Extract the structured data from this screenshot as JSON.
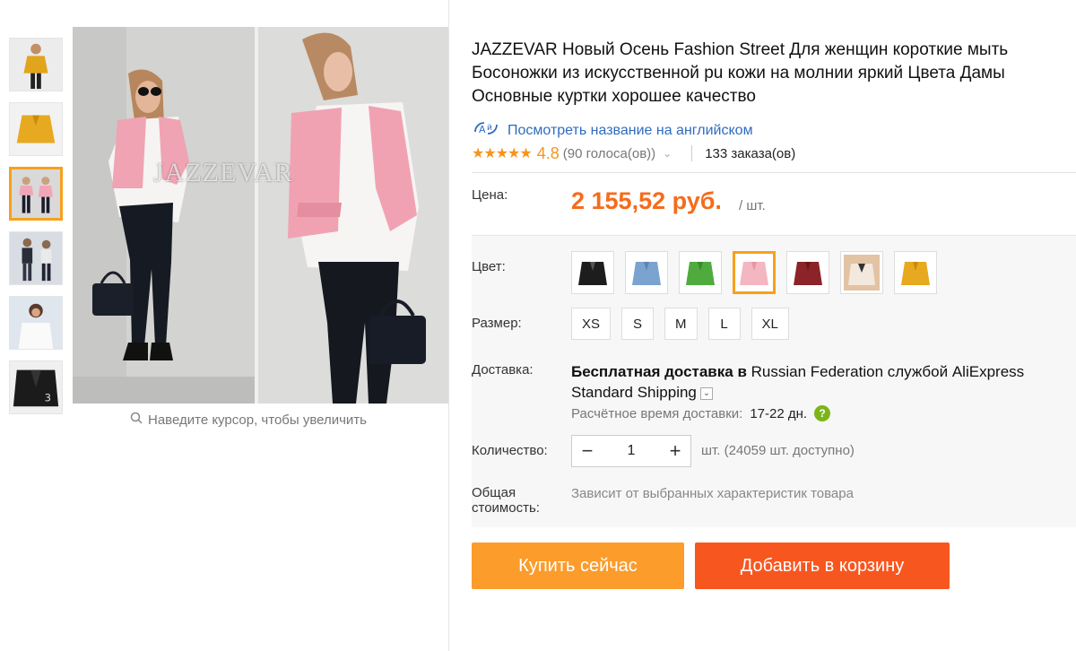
{
  "gallery": {
    "watermark": "JAZZEVAR",
    "zoom_hint": "Наведите курсор, чтобы увеличить",
    "thumbnails": [
      "yellow-jacket",
      "yellow-jacket-flat",
      "pink-jacket-street",
      "street-look",
      "white-shirt",
      "black-jacket-flat"
    ],
    "active_thumbnail": 2
  },
  "product": {
    "title": "JAZZEVAR Новый Осень Fashion Street Для женщин короткие мыть Босоножки из искусственной pu кожи на молнии яркий Цвета Дамы Основные куртки хорошее качество",
    "translate_link": "Посмотреть название на английском",
    "rating_value": "4.8",
    "votes": "(90 голоса(ов))",
    "orders": "133 заказа(ов)"
  },
  "price": {
    "label": "Цена:",
    "value": "2 155,52 руб.",
    "unit": "/ шт."
  },
  "options": {
    "color_label": "Цвет:",
    "colors": [
      "#1d1d1d",
      "#7aa3cf",
      "#4fab3e",
      "#f4b6c0",
      "#8c2328",
      "#e2c3a4",
      "#e6a91f"
    ],
    "active_color": 3,
    "size_label": "Размер:",
    "sizes": [
      "XS",
      "S",
      "M",
      "L",
      "XL"
    ]
  },
  "shipping": {
    "label": "Доставка:",
    "free": "Бесплатная доставка в",
    "rest": "Russian Federation службой AliExpress Standard Shipping",
    "time_label": "Расчётное время доставки:",
    "time_value": "17-22 дн.",
    "help": "?"
  },
  "quantity": {
    "label": "Количество:",
    "minus": "−",
    "value": "1",
    "plus": "+",
    "available": "шт. (24059 шт. доступно)"
  },
  "total": {
    "label": "Общая стоимость:",
    "value": "Зависит от выбранных характеристик товара"
  },
  "actions": {
    "buy_now": "Купить сейчас",
    "add_to_cart": "Добавить в корзину"
  },
  "colors": {
    "accent_orange": "#f66b1b",
    "buy_button": "#fb9c2b",
    "cart_button": "#f8561f",
    "link_blue": "#2f6cc0",
    "star": "#f7941d"
  }
}
